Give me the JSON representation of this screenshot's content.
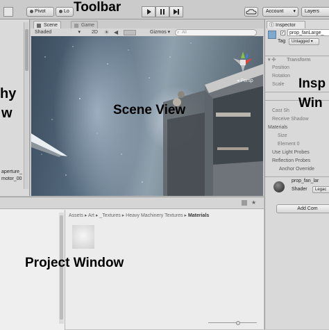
{
  "toolbar": {
    "pivot": "Pivot",
    "local": "Lo",
    "account": "Account",
    "layers": "Layers"
  },
  "scene": {
    "tab_scene": "Scene",
    "tab_game": "Game",
    "shading": "Shaded",
    "mode_2d": "2D",
    "gizmos": "Gizmos",
    "search_placeholder": "All",
    "persp": "Persp"
  },
  "hierarchy": {
    "items": [
      "aperture_",
      "motor_00"
    ]
  },
  "inspector": {
    "tab": "Inspector",
    "object_name": "prop_fanLarge_",
    "tag_label": "Tag",
    "tag_value": "Untagged",
    "transform": "Transform",
    "position": "Position",
    "rotation": "Rotation",
    "scale": "Scale",
    "cast_shadows": "Cast Sh",
    "receive_shadows": "Receive Shadow",
    "materials": "Materials",
    "size": "Size",
    "element0": "Element 0",
    "use_light_probes": "Use Light Probes",
    "reflection_probes": "Reflection Probes",
    "anchor_override": "Anchor Override",
    "material_name": "prop_fan_lar",
    "shader_label": "Shader",
    "shader_value": "Legac",
    "add_component": "Add Com"
  },
  "project": {
    "breadcrumb": [
      "Assets",
      "Art",
      "_Textures",
      "Heavy Machinery Textures",
      "Materials"
    ]
  },
  "overlays": {
    "toolbar": "Toolbar",
    "hierarchy_line1": "hy",
    "hierarchy_line2": "w",
    "scene": "Scene View",
    "inspector_line1": "Insp",
    "inspector_line2": "Win",
    "project": "Project Window"
  }
}
